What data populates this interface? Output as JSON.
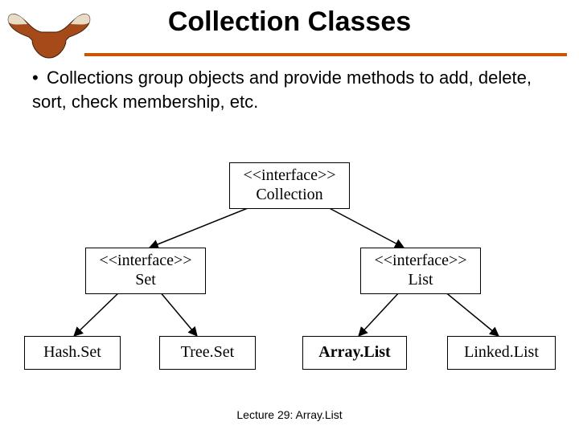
{
  "title": "Collection Classes",
  "bullet": {
    "text": "Collections group objects and provide methods to add, delete, sort, check membership, etc."
  },
  "boxes": {
    "collection": {
      "stereotype": "<<interface>>",
      "name": "Collection"
    },
    "set": {
      "stereotype": "<<interface>>",
      "name": "Set"
    },
    "list": {
      "stereotype": "<<interface>>",
      "name": "List"
    },
    "hashset": {
      "name": "Hash.Set"
    },
    "treeset": {
      "name": "Tree.Set"
    },
    "arraylist": {
      "name": "Array.List"
    },
    "linkedlist": {
      "name": "Linked.List"
    }
  },
  "footer": "Lecture 29: Array.List",
  "colors": {
    "accent": "#cc5500"
  }
}
